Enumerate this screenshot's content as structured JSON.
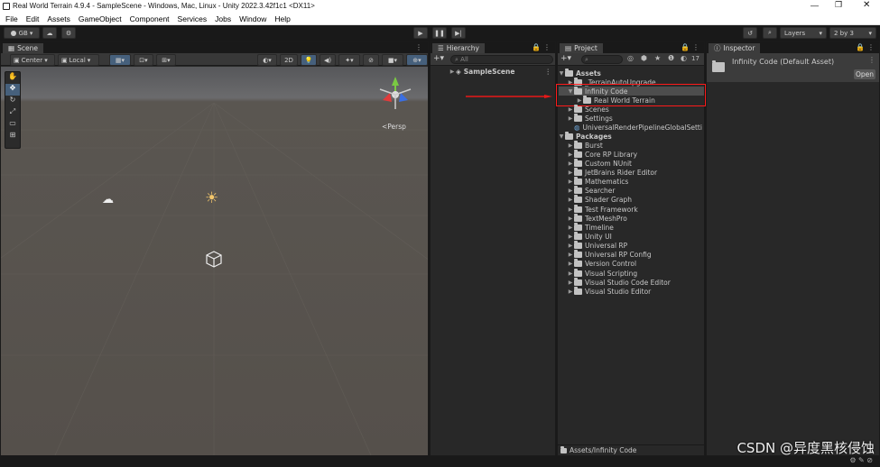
{
  "titlebar": {
    "title": "Real World Terrain 4.9.4 - SampleScene - Windows, Mac, Linux - Unity 2022.3.42f1c1 <DX11>"
  },
  "menu": [
    "File",
    "Edit",
    "Assets",
    "GameObject",
    "Component",
    "Services",
    "Jobs",
    "Window",
    "Help"
  ],
  "toolbar": {
    "account": "GB",
    "layers": "Layers",
    "layout": "2 by 3"
  },
  "scene": {
    "tab": "Scene",
    "pivot": "Center",
    "space": "Local",
    "mode2d": "2D",
    "persp": "Persp"
  },
  "hierarchy": {
    "tab": "Hierarchy",
    "search_placeholder": "All",
    "scene": "SampleScene"
  },
  "project": {
    "tab": "Project",
    "count": "17",
    "assets_label": "Assets",
    "assets_items": [
      "_TerrainAutoUpgrade",
      "Infinity Code",
      "Real World Terrain",
      "Scenes",
      "Settings",
      "UniversalRenderPipelineGlobalSetti"
    ],
    "packages_label": "Packages",
    "packages": [
      "Burst",
      "Core RP Library",
      "Custom NUnit",
      "JetBrains Rider Editor",
      "Mathematics",
      "Searcher",
      "Shader Graph",
      "Test Framework",
      "TextMeshPro",
      "Timeline",
      "Unity UI",
      "Universal RP",
      "Universal RP Config",
      "Version Control",
      "Visual Scripting",
      "Visual Studio Code Editor",
      "Visual Studio Editor"
    ],
    "footer_path": "Assets/Infinity Code"
  },
  "inspector": {
    "tab": "Inspector",
    "title": "Infinity Code (Default Asset)",
    "open_label": "Open"
  },
  "watermark": "CSDN @异度黑核侵蚀",
  "colors": {
    "highlight": "#ff1a1a",
    "selected_row": "#4d4d4d"
  }
}
